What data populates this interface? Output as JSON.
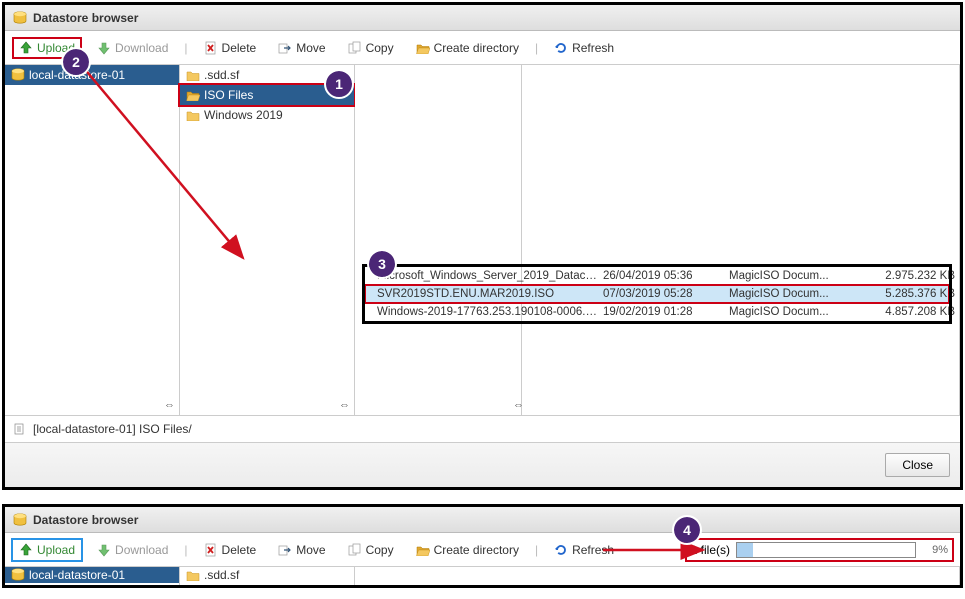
{
  "window_title": "Datastore browser",
  "toolbar": {
    "upload": "Upload",
    "download": "Download",
    "delete": "Delete",
    "move": "Move",
    "copy": "Copy",
    "create_dir": "Create directory",
    "refresh": "Refresh"
  },
  "tree": {
    "datastore": "local-datastore-01",
    "folders": [
      ".sdd.sf",
      "ISO Files",
      "Windows 2019"
    ]
  },
  "files": [
    {
      "name": "Microsoft_Windows_Server_2019_Datace...",
      "date": "26/04/2019 05:36",
      "type": "MagicISO Docum...",
      "size": "2.975.232 KB"
    },
    {
      "name": "SVR2019STD.ENU.MAR2019.ISO",
      "date": "07/03/2019 05:28",
      "type": "MagicISO Docum...",
      "size": "5.285.376 KB"
    },
    {
      "name": "Windows-2019-17763.253.190108-0006.rs...",
      "date": "19/02/2019 01:28",
      "type": "MagicISO Docum...",
      "size": "4.857.208 KB"
    }
  ],
  "path": "[local-datastore-01] ISO Files/",
  "close": "Close",
  "markers": {
    "m1": "1",
    "m2": "2",
    "m3": "3",
    "m4": "4"
  },
  "progress": {
    "label": "1 file(s)",
    "percent": "9%"
  }
}
